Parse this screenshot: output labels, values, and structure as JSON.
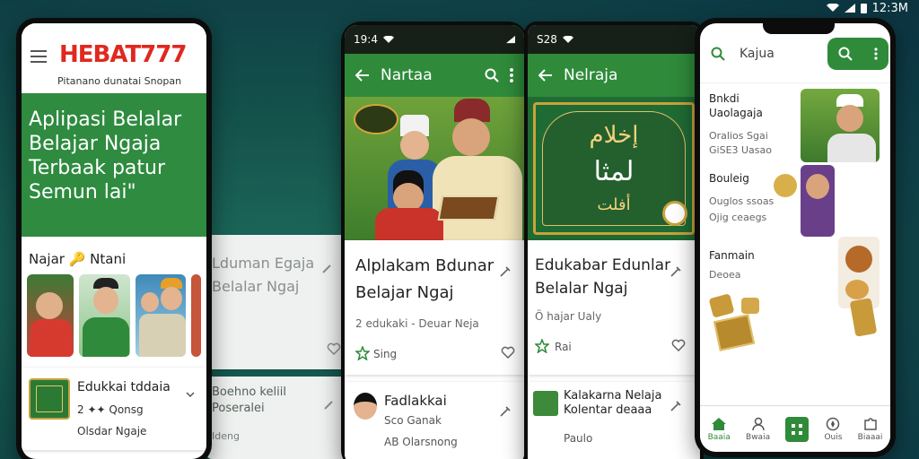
{
  "system_status": {
    "time": "12:3M"
  },
  "phone1": {
    "brand": "HEBAT777",
    "brand_sub": "Pitanano dunatai Snopan",
    "hero": [
      "Aplipasi Belalar",
      "Belajar Ngaja",
      "Terbaak patur",
      "Semun lai\""
    ],
    "section_title": "Najar 🔑 Ntani",
    "list_item": {
      "title": "Edukkai tddaia",
      "meta": "2 ✦✦ Qonsg",
      "meta2": "Olsdar Ngaje"
    }
  },
  "phone2": {
    "status_time": "19:4",
    "title": "Nartaa",
    "card_title_1": "Alplakam Bdunar",
    "card_title_2": "Belajar Ngaj",
    "card_meta": "2 edukaki - Deuar Neja",
    "card_tag": "Sing",
    "item_title": "Fadlakkai",
    "item_meta": "Sco Ganak",
    "item_meta2": "AB Olarsnong"
  },
  "phone3": {
    "status_time": "S28",
    "title": "Nelraja",
    "art_text_1": "إخلام",
    "art_text_2": "لمثا",
    "art_text_3": "أفلت",
    "card_title_1": "Edukabar Edunlar",
    "card_title_2": "Belalar Ngaj",
    "card_meta": "Ö hajar Ualy",
    "card_tag": "Rai",
    "item_title": "Kalakarna Nelaja",
    "item_sub": "Kolentar deaaa",
    "item_meta": "Paulo"
  },
  "phone4": {
    "search_placeholder": "Kajua",
    "rows": [
      {
        "title": "Bnkdi",
        "title2": "Uaolagaja",
        "meta": "Oralios Sgai",
        "meta2": "GiSE3 Uasao"
      },
      {
        "title": "Bouleig",
        "title2": "",
        "meta": "Ouglos ssoas",
        "meta2": "Ojig ceaegs"
      },
      {
        "title": "Fanmain",
        "title2": "",
        "meta": "Deoea",
        "meta2": ""
      }
    ],
    "nav": [
      {
        "label": "Baaia",
        "icon": "home-icon"
      },
      {
        "label": "Bwaia",
        "icon": "person-icon"
      },
      {
        "label": "",
        "icon": "grid-icon"
      },
      {
        "label": "Ouis",
        "icon": "compass-icon"
      },
      {
        "label": "Biaaai",
        "icon": "puzzle-icon"
      }
    ]
  },
  "ghost": {
    "a1": "Lduman Egaja",
    "a2": "Belalar Ngaj",
    "b1": "Boehno keliil",
    "b2": "Poseralei",
    "b3": "Ideng"
  },
  "colors": {
    "brand_red": "#e0281f",
    "brand_green": "#2f8b3a",
    "hero_green": "#2e8b3f"
  }
}
